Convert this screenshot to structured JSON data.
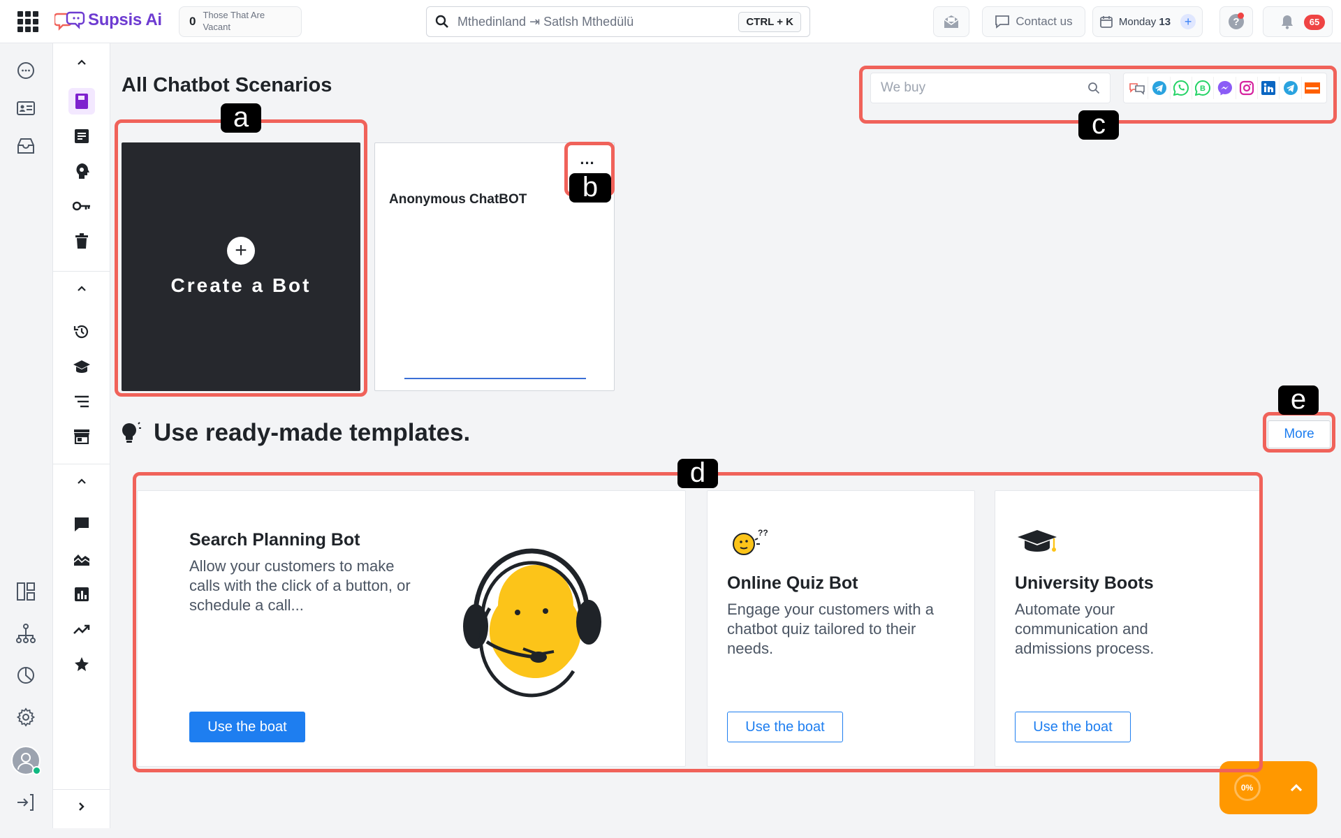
{
  "topbar": {
    "brand": "Supsis Ai",
    "vacant_count": "0",
    "vacant_label": "Those That Are Vacant",
    "search_query": "Mthedinland ⇥ Satlsh Mthedülü",
    "shortcut": "CTRL + K",
    "contact_label": "Contact us",
    "date_day": "Monday",
    "date_num": "13",
    "notifications_count": "65"
  },
  "main": {
    "title": "All Chatbot Scenarios",
    "filter_placeholder": "We buy",
    "channels": [
      "multi-channel-icon",
      "telegram-icon",
      "whatsapp-icon",
      "whatsapp-business-icon",
      "messenger-icon",
      "instagram-icon",
      "linkedin-icon",
      "telegram-icon",
      "hepsiburada-icon"
    ],
    "create_label": "Create a Bot",
    "bot_card_name": "Anonymous ChatBOT",
    "bot_more": "...",
    "templates_title": "Use ready-made templates.",
    "more_label": "More",
    "templates": [
      {
        "title": "Search Planning Bot",
        "desc": "Allow your customers to make calls with the click of a button, or schedule a call...",
        "button": "Use the boat"
      },
      {
        "title": "Online Quiz Bot",
        "desc": "Engage your customers with a chatbot quiz tailored to their needs.",
        "button": "Use the boat"
      },
      {
        "title": "University Boots",
        "desc": "Automate your communication and admissions process.",
        "button": "Use the boat"
      }
    ],
    "fab_progress": "0%"
  },
  "annotations": [
    "a",
    "b",
    "c",
    "d",
    "e"
  ],
  "colors": {
    "accent": "#1e7ef0",
    "brand": "#6d3bd1",
    "annotation": "#f0625a",
    "fab": "#ff9800",
    "dark_card": "#26282d"
  }
}
